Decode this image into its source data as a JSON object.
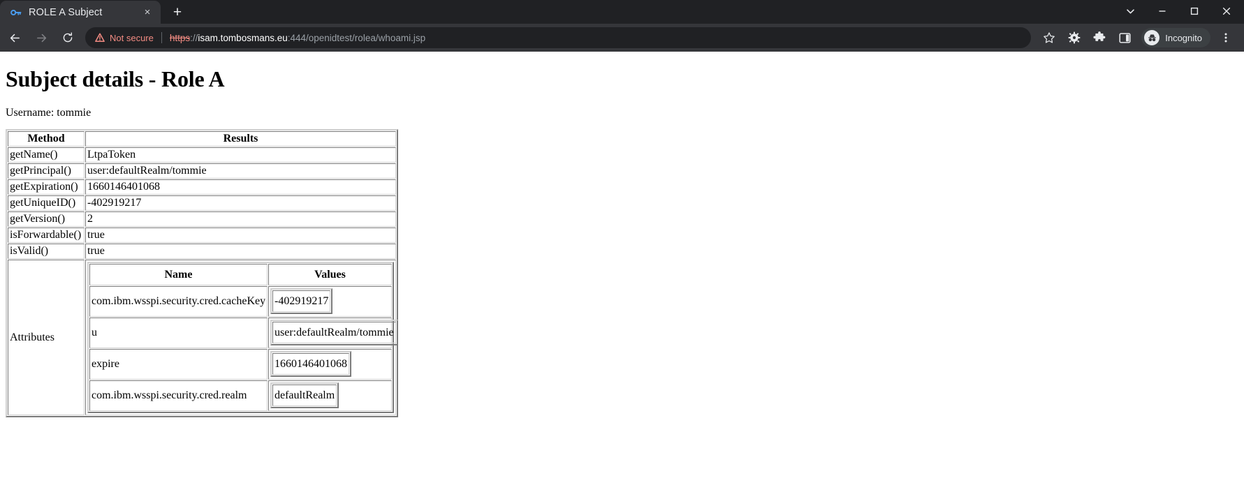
{
  "browser": {
    "tab": {
      "title": "ROLE A Subject",
      "favicon": "key-icon",
      "close_label": "×"
    },
    "new_tab_label": "+",
    "window_controls": {
      "tab_search": "tab-search-icon",
      "minimize": "minimize-icon",
      "maximize": "maximize-icon",
      "close": "close-icon"
    },
    "nav": {
      "back": "back-arrow-icon",
      "forward": "forward-arrow-icon",
      "reload": "reload-icon"
    },
    "omnibox": {
      "security_label": "Not secure",
      "security_icon": "warning-triangle-icon",
      "url_scheme": "https",
      "url_separator": "://",
      "url_host": "isam.tombosmans.eu",
      "url_rest": ":444/openidtest/rolea/whoami.jsp",
      "full_url": "https://isam.tombosmans.eu:444/openidtest/rolea/whoami.jsp"
    },
    "toolbar_icons": [
      {
        "name": "bookmark-star-icon"
      },
      {
        "name": "gear-icon"
      },
      {
        "name": "extensions-puzzle-icon"
      },
      {
        "name": "side-panel-icon"
      }
    ],
    "incognito": {
      "label": "Incognito",
      "icon": "incognito-hat-glasses-icon"
    },
    "menu_icon": "three-dot-menu-icon",
    "colors": {
      "tabstrip_bg": "#202124",
      "toolbar_bg": "#35363a",
      "omnibox_bg": "#202124",
      "not_secure": "#f28b82",
      "text_primary": "#e8eaed",
      "text_muted": "#9aa0a6"
    }
  },
  "page": {
    "title": "Subject details - Role A",
    "username_line": "Username: tommie",
    "method_table": {
      "headers": [
        "Method",
        "Results"
      ],
      "rows": [
        {
          "method": "getName()",
          "result": "LtpaToken"
        },
        {
          "method": "getPrincipal()",
          "result": "user:defaultRealm/tommie"
        },
        {
          "method": "getExpiration()",
          "result": "1660146401068"
        },
        {
          "method": "getUniqueID()",
          "result": "-402919217"
        },
        {
          "method": "getVersion()",
          "result": "2"
        },
        {
          "method": "isForwardable()",
          "result": "true"
        },
        {
          "method": "isValid()",
          "result": "true"
        }
      ],
      "attributes_label": "Attributes"
    },
    "attributes_table": {
      "headers": [
        "Name",
        "Values"
      ],
      "rows": [
        {
          "name": "com.ibm.wsspi.security.cred.cacheKey",
          "value": "-402919217"
        },
        {
          "name": "u",
          "value": "user:defaultRealm/tommie"
        },
        {
          "name": "expire",
          "value": "1660146401068"
        },
        {
          "name": "com.ibm.wsspi.security.cred.realm",
          "value": "defaultRealm"
        }
      ]
    }
  }
}
